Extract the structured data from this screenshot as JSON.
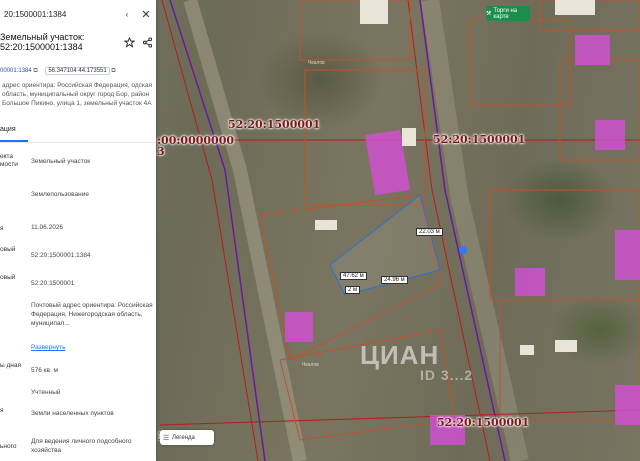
{
  "panel": {
    "cad_number_header": "20:1500001:1384",
    "title": "Земельный участок: 52:20:1500001:1384",
    "cad_number_copy": "00001:1384",
    "coords": "56.347104 44.173551",
    "address": "адрес ориентира: Российская Федерация, одская область, муниципальный округ город Бор, район Большое Пикино, улица 1, земельный участок 4А",
    "tab": "ация",
    "rows": [
      {
        "label": "екта мости",
        "value": "Земельный участок"
      },
      {
        "label": "",
        "value": "Землепользование"
      },
      {
        "label": "я",
        "value": "11.06.2026"
      },
      {
        "label": "овый",
        "value": "52:20:1500001:1384"
      },
      {
        "label": "овый",
        "value": "52:20:1500001"
      },
      {
        "label": "",
        "value": "Почтовый адрес ориентира: Российская Федерация, Нижегородская область, муниципал..."
      },
      {
        "label": "",
        "value": "Развернуть"
      },
      {
        "label": "ы дная",
        "value": "576 кв. м"
      },
      {
        "label": "",
        "value": "Учтенный"
      },
      {
        "label": "я",
        "value": "Земли населенных пунктов"
      },
      {
        "label": "ьного",
        "value": "Для ведения личного подсобного хозяйства"
      }
    ]
  },
  "map": {
    "labels": [
      "52:20:1500001",
      "52:20:1500001",
      ":00:0000000",
      "3",
      "52:20:1500001",
      "1"
    ],
    "measures": [
      "22.03 м",
      "47.62 м",
      "2 м",
      "24.96 м"
    ],
    "road_labels": [
      "Чкалов",
      "Чкалов"
    ],
    "legend_label": "Легенда",
    "torgi_label": "Торги на карте",
    "watermark": "ЦИАН",
    "watermark_sub": "ID 3...2"
  },
  "colors": {
    "accent": "#1f6fff",
    "parcel": "#7a1a1a",
    "building": "#d44fd6",
    "torgi": "#1f8b4c"
  }
}
